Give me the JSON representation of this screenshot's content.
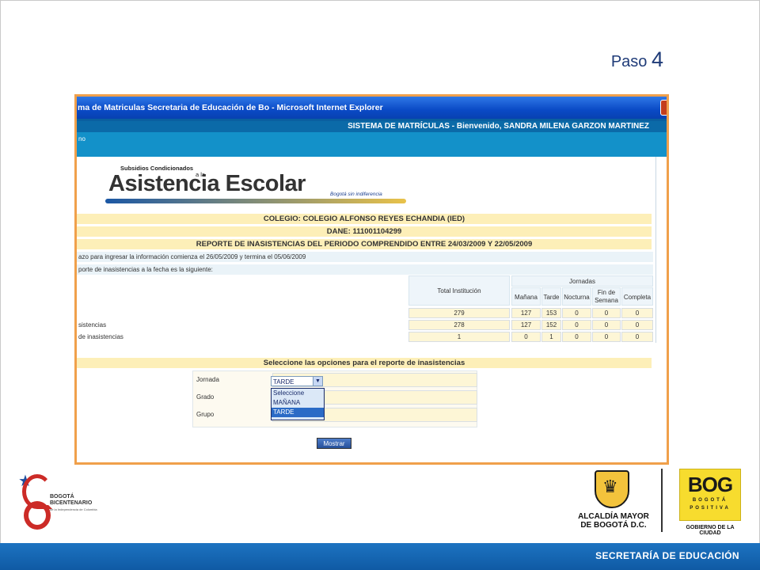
{
  "slide": {
    "paso_label": "Paso",
    "paso_number": "4",
    "footer_text": "SECRETARÍA DE EDUCACIÓN"
  },
  "browser": {
    "window_title": "ma de Matriculas Secretaria de Educación de Bo - Microsoft Internet Explorer",
    "system_line": "SISTEMA DE MATRÍCULAS   -   Bienvenido, SANDRA MILENA GARZON MARTINEZ",
    "left_stub": "no"
  },
  "app_logo": {
    "subtitle": "Subsidios Condicionados",
    "connector": "a la",
    "title": "Asistencia Escolar",
    "tagline": "Bogotá sin indiferencia"
  },
  "report": {
    "colegio": "COLEGIO: COLEGIO ALFONSO REYES ECHANDIA (IED)",
    "dane": "DANE: 111001104299",
    "periodo": "REPORTE DE INASISTENCIAS DEL PERIODO COMPRENDIDO ENTRE 24/03/2009 Y 22/05/2009",
    "plazo_text": "azo para ingresar la información comienza el 26/05/2009 y termina el 05/06/2009",
    "reporte_text": "porte de inasistencias a la fecha es la siguiente:",
    "col_total": "Total Institución",
    "col_jornadas": "Jornadas",
    "col_manana": "Mañana",
    "col_tarde": "Tarde",
    "col_nocturna": "Nocturna",
    "col_fin_semana": "Fin de Semana",
    "col_completa": "Completa",
    "rows": [
      {
        "label": "",
        "total": "279",
        "manana": "127",
        "tarde": "153",
        "nocturna": "0",
        "fin": "0",
        "completa": "0"
      },
      {
        "label": "sistencias",
        "total": "278",
        "manana": "127",
        "tarde": "152",
        "nocturna": "0",
        "fin": "0",
        "completa": "0"
      },
      {
        "label": " de inasistencias",
        "total": "1",
        "manana": "0",
        "tarde": "1",
        "nocturna": "0",
        "fin": "0",
        "completa": "0"
      }
    ]
  },
  "options_form": {
    "header": "Seleccione las opciones para el reporte de inasistencias",
    "jornada_label": "Jornada",
    "grado_label": "Grado",
    "grupo_label": "Grupo",
    "jornada_value": "TARDE",
    "dropdown_options": [
      "Seleccione",
      "MAÑANA",
      "TARDE"
    ],
    "submit_label": "Mostrar"
  },
  "logos": {
    "bicentenario_line1": "BOGOTÁ",
    "bicentenario_line2": "BICENTENARIO",
    "bicentenario_line3": "de la Independencia de Colombia",
    "alcaldia_line1": "ALCALDÍA MAYOR",
    "alcaldia_line2": "DE BOGOTÁ D.C.",
    "bog_main": "BOG",
    "bog_line1": "BOGOTÁ",
    "bog_line2": "POSITIVA",
    "bog_subtitle": "GOBIERNO DE LA CIUDAD"
  }
}
